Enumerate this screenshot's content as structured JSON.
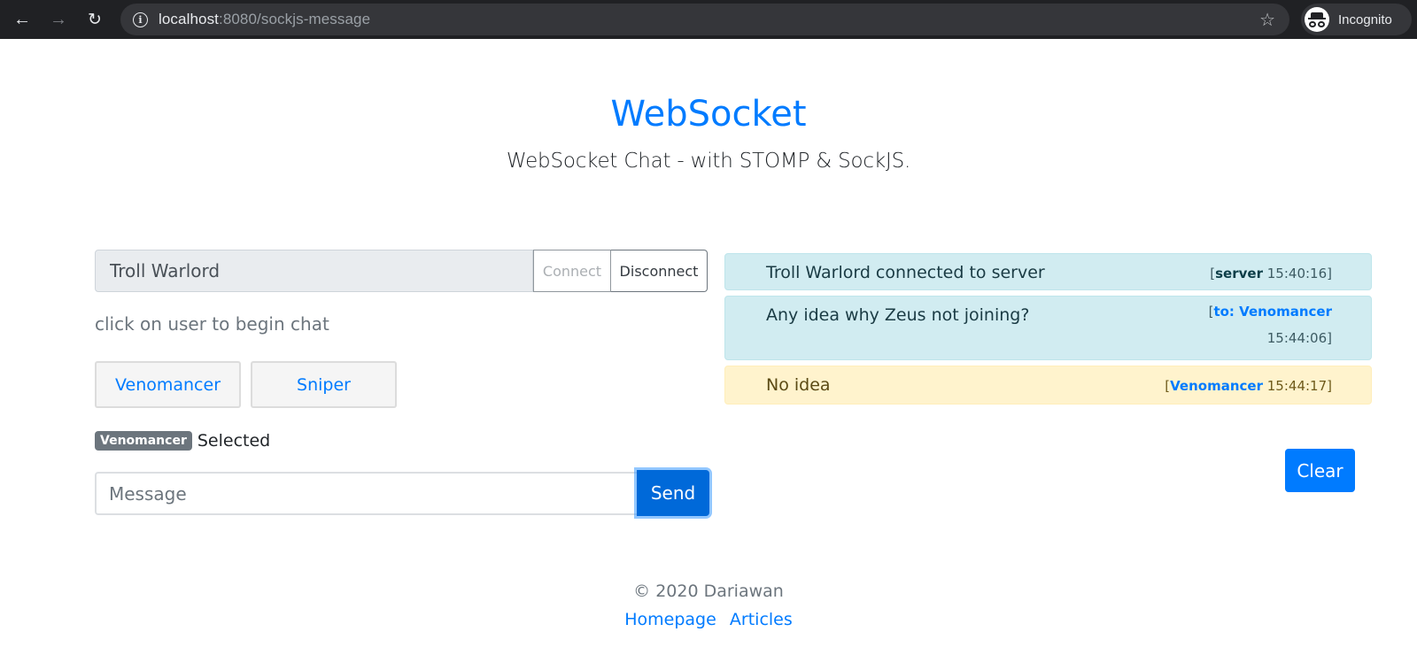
{
  "browser": {
    "url_host": "localhost",
    "url_rest": ":8080/sockjs-message",
    "profile_label": "Incognito"
  },
  "header": {
    "title": "WebSocket",
    "subtitle": "WebSocket Chat - with STOMP & SockJS."
  },
  "connection": {
    "username_value": "Troll Warlord",
    "connect_label": "Connect",
    "disconnect_label": "Disconnect"
  },
  "users": {
    "hint": "click on user to begin chat",
    "list": [
      {
        "label": "Venomancer"
      },
      {
        "label": "Sniper"
      }
    ],
    "selected_badge": "Venomancer",
    "selected_label": "Selected"
  },
  "compose": {
    "placeholder": "Message",
    "send_label": "Send"
  },
  "messages": [
    {
      "type": "info",
      "text": "Troll Warlord connected to server",
      "open": "[",
      "sender": "server",
      "time": "15:40:16",
      "close": "]"
    },
    {
      "type": "info",
      "text": "Any idea why Zeus not joining?",
      "open": "[",
      "sender": "to: Venomancer",
      "time": "15:44:06",
      "close": "]"
    },
    {
      "type": "warning",
      "text": "No idea",
      "open": "[",
      "sender": "Venomancer",
      "time": "15:44:17",
      "close": "]"
    }
  ],
  "clear_label": "Clear",
  "footer": {
    "copyright": "© 2020 Dariawan",
    "links": [
      {
        "label": "Homepage"
      },
      {
        "label": "Articles"
      }
    ]
  },
  "colors": {
    "primary": "#007bff",
    "info_bg": "#d1ecf1",
    "warning_bg": "#fff3cd",
    "badge_bg": "#6c757d"
  }
}
